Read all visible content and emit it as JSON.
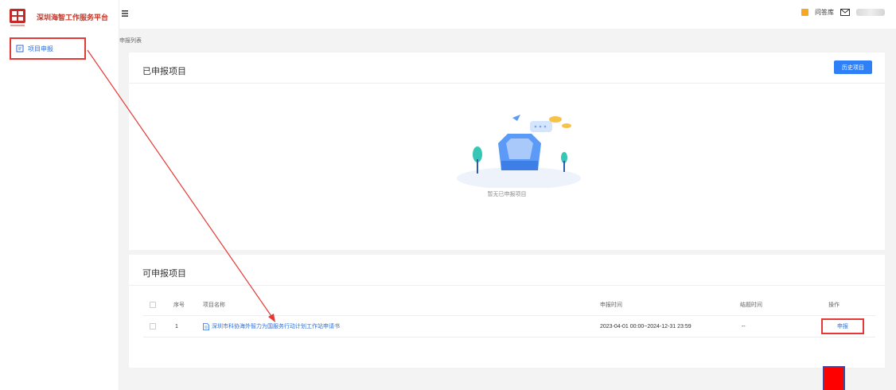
{
  "app": {
    "brand_name": "深圳海智工作服务平台"
  },
  "sidebar": {
    "items": [
      {
        "label": "项目申报",
        "icon": "document-icon"
      }
    ]
  },
  "header": {
    "help_label": "问答库"
  },
  "breadcrumb": "申报列表",
  "declared_section": {
    "title": "已申报项目",
    "history_button": "历史项目",
    "empty_text": "暂无已申报项目"
  },
  "available_section": {
    "title": "可申报项目",
    "columns": [
      "序号",
      "项目名称",
      "申报时间",
      "结题时间",
      "操作"
    ],
    "rows": [
      {
        "index": "1",
        "name": "深圳市科协海外智力为国服务行动计划工作站申请书",
        "apply_time": "2023-04-01 00:00~2024-12-31 23:59",
        "end_time": "--",
        "action": "申报"
      }
    ]
  },
  "colors": {
    "accent": "#2f7ff7",
    "link": "#2f6fd6",
    "annotation_red": "#e53935",
    "brand_red": "#c0392b"
  }
}
